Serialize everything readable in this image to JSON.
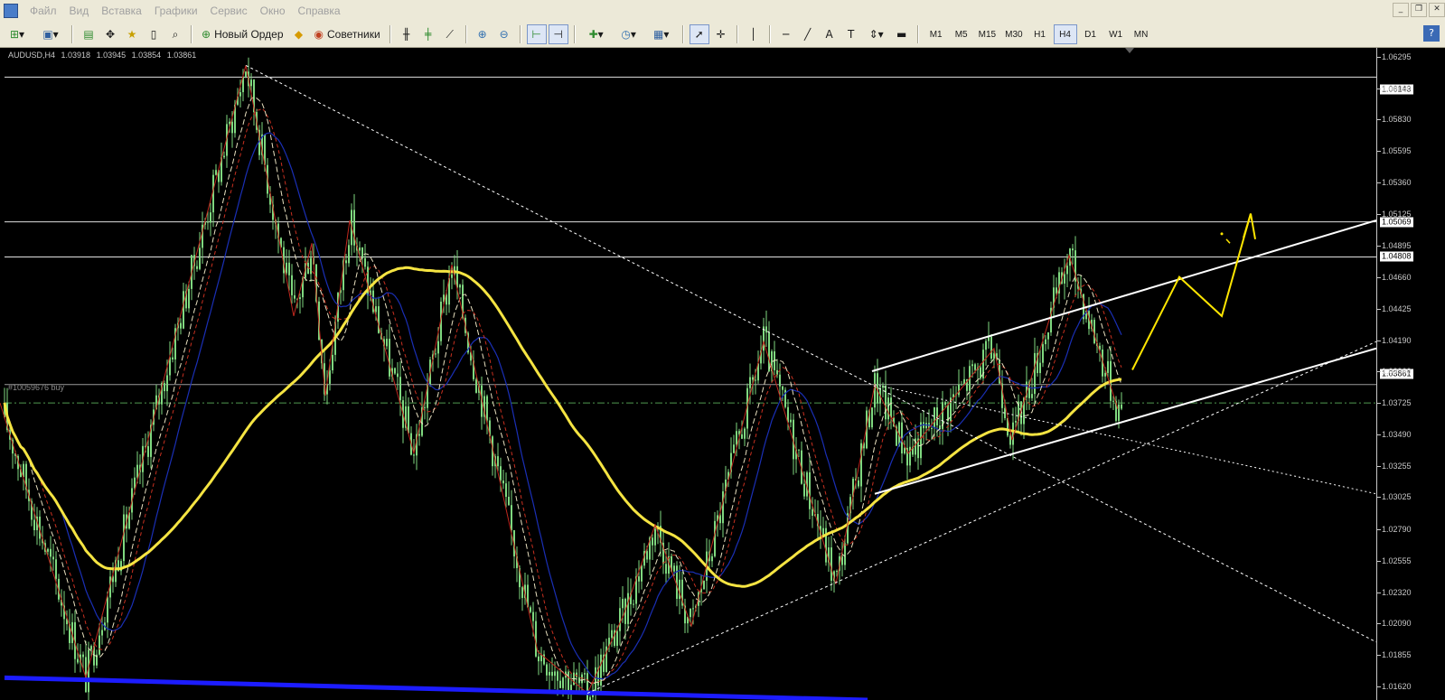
{
  "menu": {
    "items": [
      "Файл",
      "Вид",
      "Вставка",
      "Графики",
      "Сервис",
      "Окно",
      "Справка"
    ],
    "window_controls": [
      "minimize",
      "restore",
      "close"
    ]
  },
  "toolbar": {
    "new_order_label": "Новый Ордер",
    "advisors_label": "Советники",
    "timeframes": [
      "M1",
      "M5",
      "M15",
      "M30",
      "H1",
      "H4",
      "D1",
      "W1",
      "MN"
    ],
    "selected_timeframe": "H4"
  },
  "chart": {
    "symbol": "AUDUSD,H4",
    "open": "1.03918",
    "high": "1.03945",
    "low": "1.03854",
    "close": "1.03861",
    "order_label": "#10059676 buy",
    "background": "#000000",
    "candle_color": "#7fd87f",
    "colors": {
      "ma_long": "#f5e442",
      "ma_blue": "#1a2fb5",
      "ma_red": "#c83020",
      "ma_white": "#e8e0c0",
      "zigzag": "#c0281e",
      "support": "#1c1cff",
      "channel": "#ffffff",
      "forecast": "#ffe600"
    }
  },
  "price_axis": {
    "ticks": [
      "1.06295",
      "1.06060",
      "1.05830",
      "1.05595",
      "1.05360",
      "1.05125",
      "1.04895",
      "1.04660",
      "1.04425",
      "1.04190",
      "1.03960",
      "1.03725",
      "1.03490",
      "1.03255",
      "1.03025",
      "1.02790",
      "1.02555",
      "1.02320",
      "1.02090",
      "1.01855",
      "1.01620"
    ],
    "labels": {
      "level_1": "1.06143",
      "level_2": "1.05069",
      "level_3": "1.04808",
      "current": "1.03861"
    }
  },
  "chart_data": {
    "type": "candlestick",
    "symbol": "AUDUSD",
    "timeframe": "H4",
    "horizontal_levels": [
      1.06143,
      1.05069,
      1.04808
    ],
    "current_price": 1.03861,
    "order_price": 1.03725,
    "ylim": [
      1.0152,
      1.0636
    ],
    "zigzag_points": [
      [
        0,
        1.03725
      ],
      [
        95,
        1.01685
      ],
      [
        272,
        1.0623
      ],
      [
        325,
        1.0437
      ],
      [
        345,
        1.0491
      ],
      [
        360,
        1.0378
      ],
      [
        387,
        1.0508
      ],
      [
        458,
        1.0335
      ],
      [
        500,
        1.0475
      ],
      [
        595,
        1.0188
      ],
      [
        650,
        1.0157
      ],
      [
        690,
        1.0215
      ],
      [
        725,
        1.0282
      ],
      [
        765,
        1.0207
      ],
      [
        845,
        1.0418
      ],
      [
        925,
        1.0238
      ],
      [
        968,
        1.0386
      ],
      [
        1005,
        1.0335
      ],
      [
        1100,
        1.0413
      ],
      [
        1120,
        1.0345
      ],
      [
        1183,
        1.0482
      ],
      [
        1237,
        1.0368
      ]
    ]
  }
}
